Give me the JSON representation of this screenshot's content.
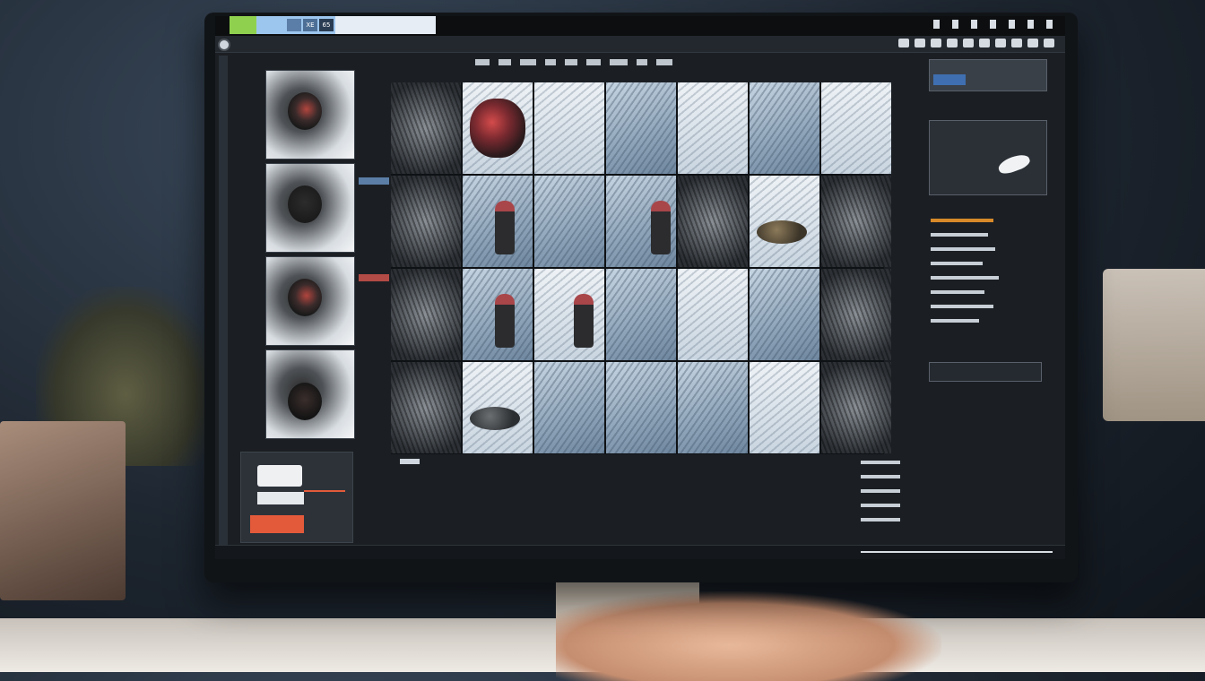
{
  "window": {
    "tabs": [
      {
        "label": ""
      },
      {
        "label": "XE"
      },
      {
        "label": "65"
      }
    ]
  },
  "grid": {
    "rows": 4,
    "columns": 7
  },
  "colors": {
    "accent_green": "#8fd14f",
    "accent_blue": "#9dc6ee",
    "accent_orange": "#e35a3a",
    "panel_bg": "#1b1f24"
  },
  "icons": {
    "close": "close-dot-icon",
    "tools": [
      "tool-icon-1",
      "tool-icon-2",
      "tool-icon-3",
      "tool-icon-4",
      "tool-icon-5",
      "tool-icon-6",
      "tool-icon-7",
      "tool-icon-8",
      "tool-icon-9",
      "tool-icon-10"
    ]
  }
}
